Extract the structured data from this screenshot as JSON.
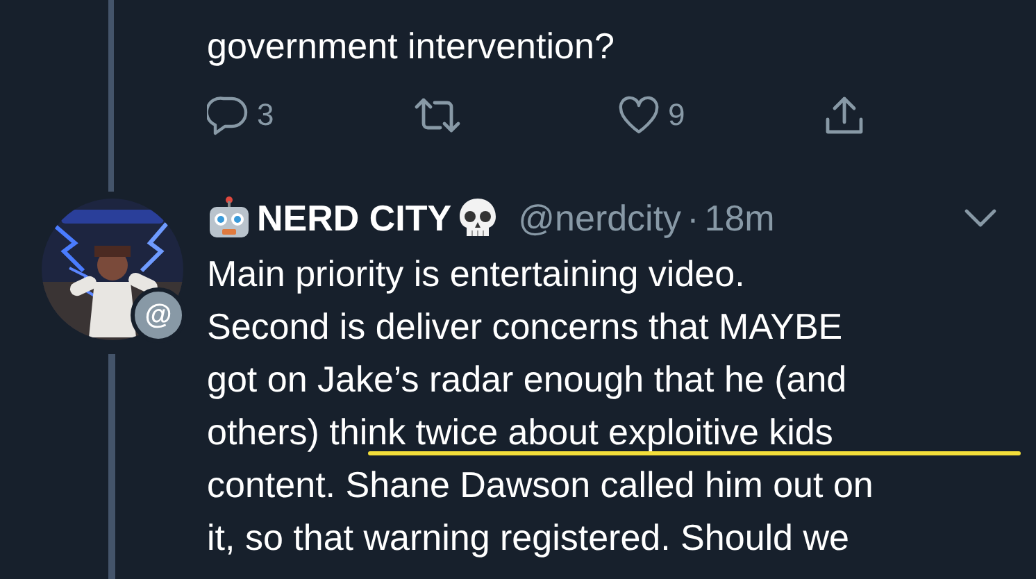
{
  "previous_tweet": {
    "text_lines": [
      "government intervention?"
    ],
    "actions": [
      {
        "kind": "reply",
        "count": "3"
      },
      {
        "kind": "retweet"
      },
      {
        "kind": "like",
        "count": "9"
      },
      {
        "kind": "share"
      }
    ]
  },
  "tweet": {
    "avatar": {
      "kind": "picture",
      "badge": "@"
    },
    "name": "NERD CITY",
    "handle": "@nerdcity",
    "separator": "·",
    "time": "18m",
    "text_lines": [
      "Main priority is entertaining video.",
      "Second is deliver concerns that MAYBE",
      "got on Jake’s radar enough that he (and",
      "others) think twice about exploitive kids",
      "content. Shane Dawson called him out on",
      "it, so that warning registered. Should we"
    ],
    "annotations": [
      {
        "kind": "underline",
        "color": "#f3de3a"
      }
    ]
  }
}
